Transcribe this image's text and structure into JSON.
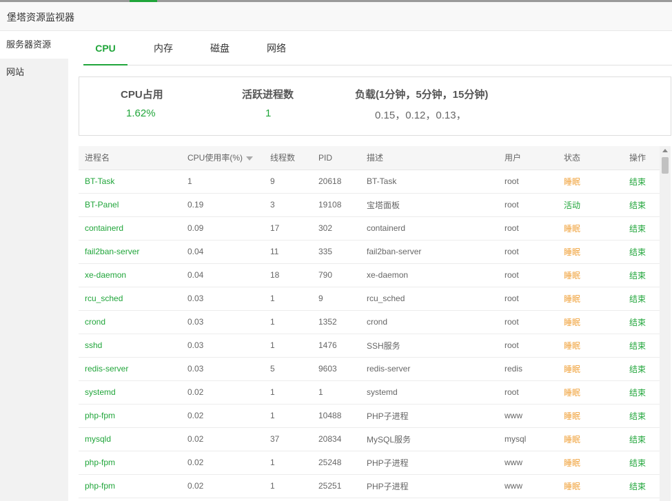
{
  "window": {
    "title": "堡塔资源监视器"
  },
  "sidebar": {
    "items": [
      {
        "label": "服务器资源"
      },
      {
        "label": "网站"
      }
    ]
  },
  "tabs": [
    {
      "label": "CPU"
    },
    {
      "label": "内存"
    },
    {
      "label": "磁盘"
    },
    {
      "label": "网络"
    }
  ],
  "stats": {
    "cpu_label": "CPU占用",
    "cpu_value": "1.62%",
    "proc_label": "活跃进程数",
    "proc_value": "1",
    "load_label": "负载(1分钟，5分钟，15分钟)",
    "load_value": "0.15，0.12，0.13，"
  },
  "table": {
    "headers": [
      "进程名",
      "CPU使用率(%)",
      "线程数",
      "PID",
      "描述",
      "用户",
      "状态",
      "操作"
    ],
    "rows": [
      {
        "name": "BT-Task",
        "cpu": "1",
        "threads": "9",
        "pid": "20618",
        "desc": "BT-Task",
        "user": "root",
        "status": "睡眠",
        "action": "结束"
      },
      {
        "name": "BT-Panel",
        "cpu": "0.19",
        "threads": "3",
        "pid": "19108",
        "desc": "宝塔面板",
        "user": "root",
        "status": "活动",
        "action": "结束"
      },
      {
        "name": "containerd",
        "cpu": "0.09",
        "threads": "17",
        "pid": "302",
        "desc": "containerd",
        "user": "root",
        "status": "睡眠",
        "action": "结束"
      },
      {
        "name": "fail2ban-server",
        "cpu": "0.04",
        "threads": "11",
        "pid": "335",
        "desc": "fail2ban-server",
        "user": "root",
        "status": "睡眠",
        "action": "结束"
      },
      {
        "name": "xe-daemon",
        "cpu": "0.04",
        "threads": "18",
        "pid": "790",
        "desc": "xe-daemon",
        "user": "root",
        "status": "睡眠",
        "action": "结束"
      },
      {
        "name": "rcu_sched",
        "cpu": "0.03",
        "threads": "1",
        "pid": "9",
        "desc": "rcu_sched",
        "user": "root",
        "status": "睡眠",
        "action": "结束"
      },
      {
        "name": "crond",
        "cpu": "0.03",
        "threads": "1",
        "pid": "1352",
        "desc": "crond",
        "user": "root",
        "status": "睡眠",
        "action": "结束"
      },
      {
        "name": "sshd",
        "cpu": "0.03",
        "threads": "1",
        "pid": "1476",
        "desc": "SSH服务",
        "user": "root",
        "status": "睡眠",
        "action": "结束"
      },
      {
        "name": "redis-server",
        "cpu": "0.03",
        "threads": "5",
        "pid": "9603",
        "desc": "redis-server",
        "user": "redis",
        "status": "睡眠",
        "action": "结束"
      },
      {
        "name": "systemd",
        "cpu": "0.02",
        "threads": "1",
        "pid": "1",
        "desc": "systemd",
        "user": "root",
        "status": "睡眠",
        "action": "结束"
      },
      {
        "name": "php-fpm",
        "cpu": "0.02",
        "threads": "1",
        "pid": "10488",
        "desc": "PHP子进程",
        "user": "www",
        "status": "睡眠",
        "action": "结束"
      },
      {
        "name": "mysqld",
        "cpu": "0.02",
        "threads": "37",
        "pid": "20834",
        "desc": "MySQL服务",
        "user": "mysql",
        "status": "睡眠",
        "action": "结束"
      },
      {
        "name": "php-fpm",
        "cpu": "0.02",
        "threads": "1",
        "pid": "25248",
        "desc": "PHP子进程",
        "user": "www",
        "status": "睡眠",
        "action": "结束"
      },
      {
        "name": "php-fpm",
        "cpu": "0.02",
        "threads": "1",
        "pid": "25251",
        "desc": "PHP子进程",
        "user": "www",
        "status": "睡眠",
        "action": "结束"
      }
    ]
  },
  "colors": {
    "accent": "#20a53a",
    "sleep": "#f0a23b"
  }
}
